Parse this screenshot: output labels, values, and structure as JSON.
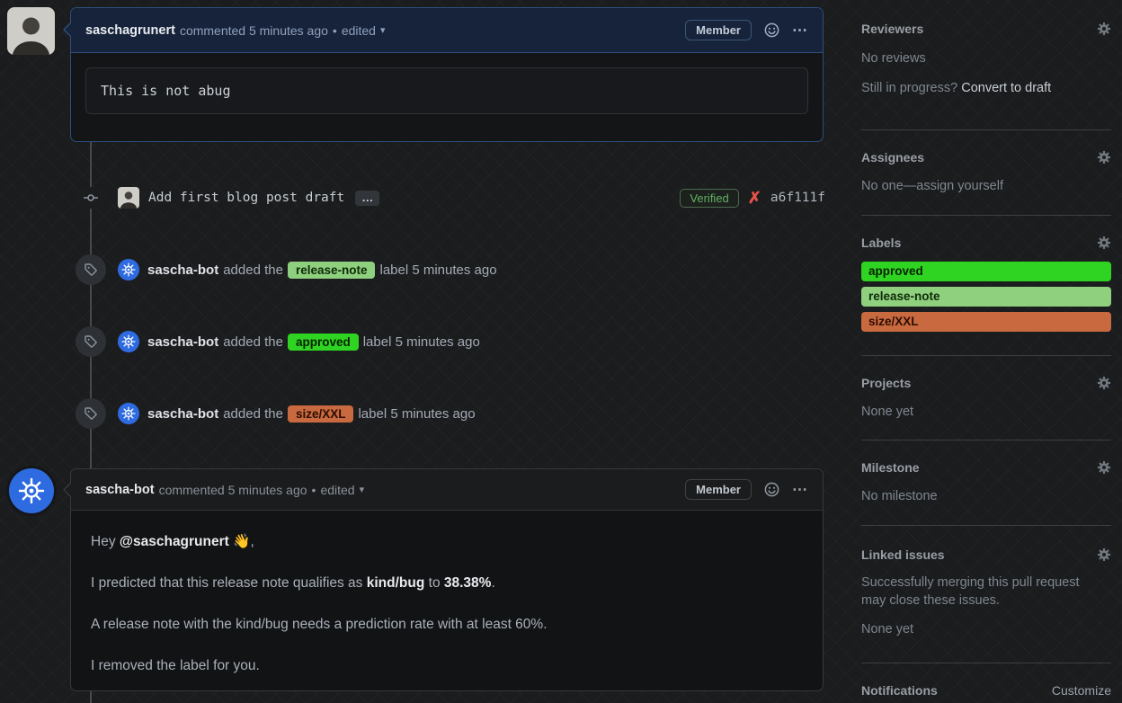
{
  "comment1": {
    "author": "saschagrunert",
    "meta": "commented 5 minutes ago",
    "separator": "•",
    "edited_label": "edited",
    "member_badge": "Member",
    "code_body": "This is not abug"
  },
  "commit": {
    "message": "Add first blog post draft",
    "expander": "…",
    "verified_badge": "Verified",
    "status_icon": "✗",
    "sha": "a6f111f"
  },
  "events": [
    {
      "actor": "sascha-bot",
      "prefix": "added the",
      "label": "release-note",
      "label_bg": "#8fd07f",
      "label_fg": "#0e2a08",
      "suffix": "label 5 minutes ago"
    },
    {
      "actor": "sascha-bot",
      "prefix": "added the",
      "label": "approved",
      "label_bg": "#2fd321",
      "label_fg": "#062200",
      "suffix": "label 5 minutes ago"
    },
    {
      "actor": "sascha-bot",
      "prefix": "added the",
      "label": "size/XXL",
      "label_bg": "#c9693f",
      "label_fg": "#2b0d02",
      "suffix": "label 5 minutes ago"
    }
  ],
  "comment2": {
    "author": "sascha-bot",
    "meta": "commented 5 minutes ago",
    "separator": "•",
    "edited_label": "edited",
    "member_badge": "Member",
    "p1_prefix": "Hey ",
    "p1_mention": "@saschagrunert",
    "p1_emoji": "👋",
    "p1_suffix": ",",
    "p2_prefix": "I predicted that this release note qualifies as ",
    "p2_bold1": "kind/bug",
    "p2_mid": " to ",
    "p2_bold2": "38.38%",
    "p2_suffix": ".",
    "p3": "A release note with the kind/bug needs a prediction rate with at least 60%.",
    "p4": "I removed the label for you."
  },
  "sidebar": {
    "reviewers": {
      "title": "Reviewers",
      "empty": "No reviews",
      "progress_question": "Still in progress?",
      "convert_link": "Convert to draft"
    },
    "assignees": {
      "title": "Assignees",
      "empty_prefix": "No one—",
      "self_assign": "assign yourself"
    },
    "labels": {
      "title": "Labels",
      "items": [
        {
          "name": "approved",
          "bg": "#2fd321",
          "fg": "#062200"
        },
        {
          "name": "release-note",
          "bg": "#8fd07f",
          "fg": "#0e2a08"
        },
        {
          "name": "size/XXL",
          "bg": "#c9693f",
          "fg": "#2b0d02"
        }
      ]
    },
    "projects": {
      "title": "Projects",
      "empty": "None yet"
    },
    "milestone": {
      "title": "Milestone",
      "empty": "No milestone"
    },
    "linked_issues": {
      "title": "Linked issues",
      "description": "Successfully merging this pull request may close these issues.",
      "empty": "None yet"
    },
    "notifications": {
      "title": "Notifications",
      "customize_link": "Customize"
    }
  },
  "colors": {
    "highlight_comment_border": "#2d4f7c",
    "highlight_comment_header": "#17233a",
    "verified_green": "#63b063",
    "check_failed_red": "#e5534b",
    "kubernetes_blue": "#2f6be0"
  }
}
